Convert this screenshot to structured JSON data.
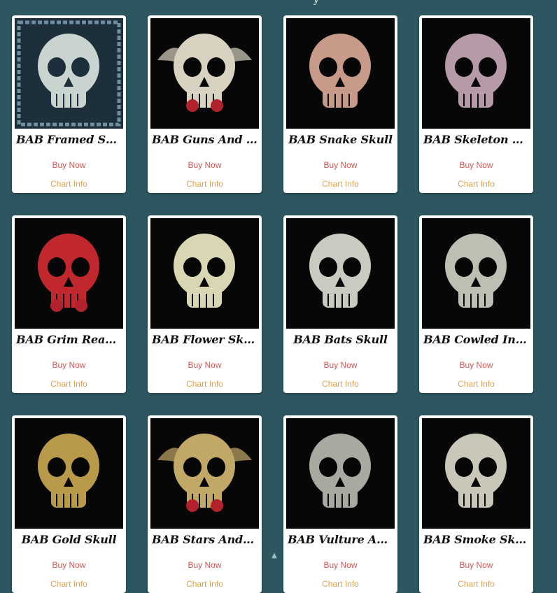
{
  "page": {
    "heading_fragment": "y",
    "buy_label": "Buy Now",
    "chart_label": "Chart Info"
  },
  "colors": {
    "background": "#2d5760",
    "card": "#ffffff",
    "buy_link": "#d9534f",
    "chart_link": "#e3a14a"
  },
  "products": [
    {
      "title": "BAB Framed Skull",
      "art": "framed-skull",
      "palette": "#c9d3d0"
    },
    {
      "title": "BAB Guns And R...",
      "art": "guns-skull",
      "palette": "#d8d2c0"
    },
    {
      "title": "BAB Snake Skull",
      "art": "snake-skull",
      "palette": "#c79a8a"
    },
    {
      "title": "BAB Skeleton Fas...",
      "art": "skeleton",
      "palette": "#b79aa7"
    },
    {
      "title": "BAB Grim Reaper",
      "art": "reaper",
      "palette": "#c0282e"
    },
    {
      "title": "BAB Flower Skull",
      "art": "flower-skull",
      "palette": "#d9d6b4"
    },
    {
      "title": "BAB Bats Skull",
      "art": "bats-skull",
      "palette": "#c8cbc0"
    },
    {
      "title": "BAB Cowled In W...",
      "art": "cowled-skull",
      "palette": "#bdbfb2"
    },
    {
      "title": "BAB Gold Skull",
      "art": "gold-skull",
      "palette": "#b89a4a"
    },
    {
      "title": "BAB Stars And R...",
      "art": "winged-skull",
      "palette": "#c2a866"
    },
    {
      "title": "BAB Vulture And ...",
      "art": "vulture-skull",
      "palette": "#a9a9a2"
    },
    {
      "title": "BAB Smoke Skull",
      "art": "smoke-skull",
      "palette": "#c9c8b8"
    }
  ]
}
